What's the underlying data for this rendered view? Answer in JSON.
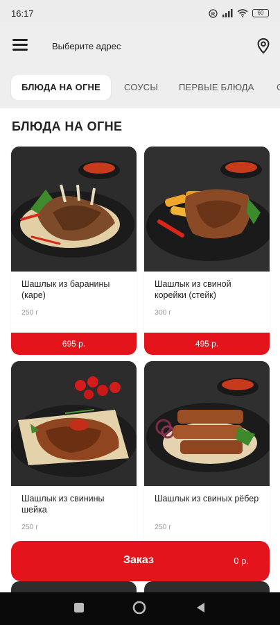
{
  "status_bar": {
    "time": "16:17",
    "battery": "60"
  },
  "header": {
    "address_label": "Выберите адрес"
  },
  "tabs": [
    {
      "label": "БЛЮДА НА ОГНЕ",
      "active": true
    },
    {
      "label": "СОУСЫ",
      "active": false
    },
    {
      "label": "ПЕРВЫЕ БЛЮДА",
      "active": false
    },
    {
      "label": "С",
      "active": false
    }
  ],
  "section": {
    "title": "БЛЮДА НА ОГНЕ"
  },
  "products": [
    {
      "name": "Шашлык из баранины (каре)",
      "weight": "250 г",
      "price": "695 р."
    },
    {
      "name": "Шашлык из свиной корейки (стейк)",
      "weight": "300 г",
      "price": "495 р."
    },
    {
      "name": "Шашлык из свинины шейка",
      "weight": "250 г",
      "price": ""
    },
    {
      "name": "Шашлык из свиных рёбер",
      "weight": "250 г",
      "price": ""
    }
  ],
  "order": {
    "label": "Заказ",
    "total": "0 р."
  },
  "icons": {
    "menu": "hamburger-menu-icon",
    "location": "location-pin-icon",
    "nav_recents": "square-icon",
    "nav_home": "circle-icon",
    "nav_back": "triangle-back-icon"
  },
  "colors": {
    "accent": "#e3141b",
    "background_grey": "#eeeeee",
    "nav_bar": "#0a0a0a"
  }
}
